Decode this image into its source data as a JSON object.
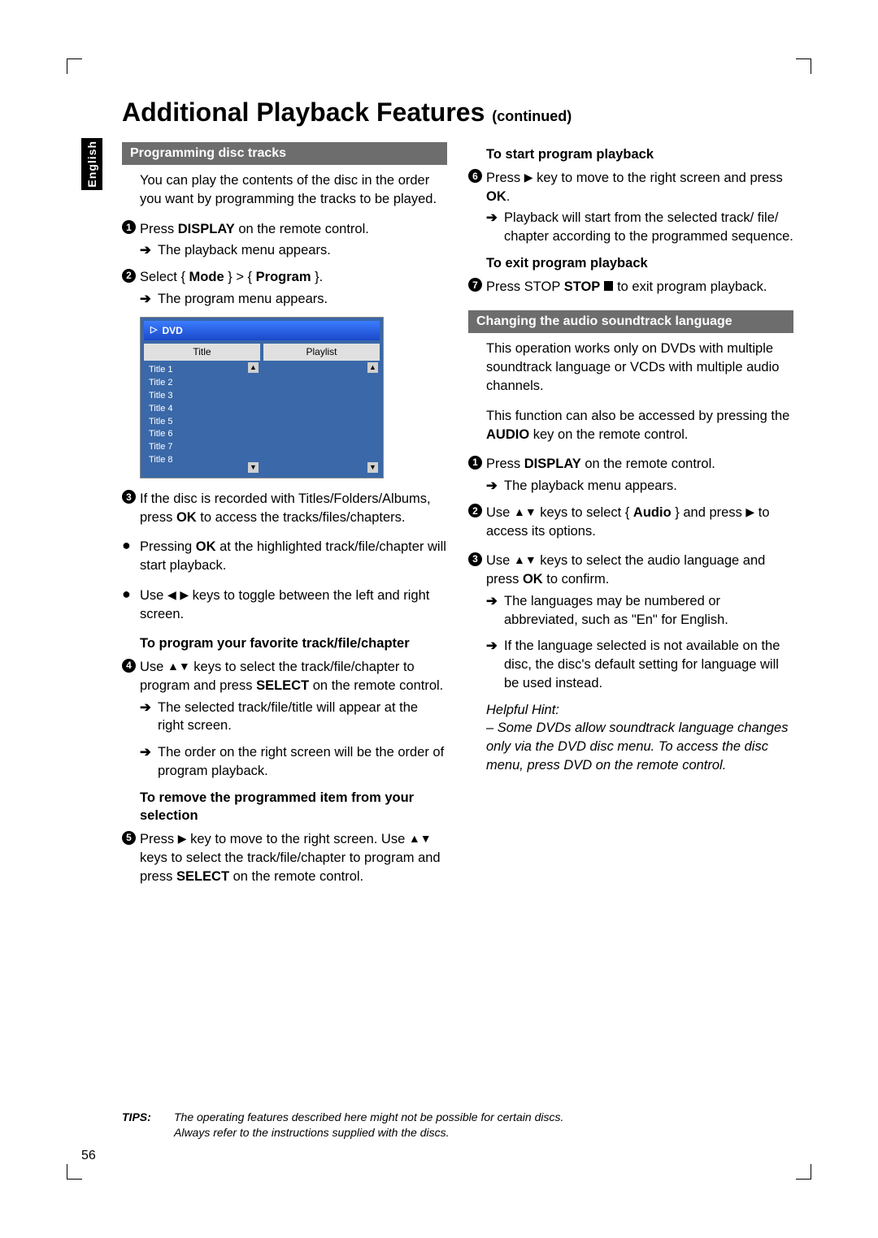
{
  "page_number": "56",
  "language_tab": "English",
  "title_main": "Additional Playback Features",
  "title_suffix": "(continued)",
  "section1": "Programming disc tracks",
  "intro1": "You can play the contents of the disc in the order you want by programming the tracks to be played.",
  "s1": "Press DISPLAY on the remote control.",
  "s1r": "The playback menu appears.",
  "s2": "Select { Mode } > { Program }.",
  "s2r": "The program menu appears.",
  "screenshot": {
    "hdr": "DVD",
    "left_h": "Title",
    "right_h": "Playlist",
    "titles": [
      "Title 1",
      "Title 2",
      "Title 3",
      "Title 4",
      "Title 5",
      "Title 6",
      "Title 7",
      "Title 8"
    ]
  },
  "s3": "If the disc is recorded with Titles/Folders/Albums, press OK to access the tracks/files/chapters.",
  "b1": "Pressing OK at the highlighted track/file/chapter will start playback.",
  "b2": "Use ◀ ▶ keys to toggle between the left and right screen.",
  "h1": "To program your favorite track/file/chapter",
  "s4": "Use ▲▼ keys to select the track/file/chapter to program and press SELECT on the remote control.",
  "s4r1": "The selected track/file/title will appear at the right screen.",
  "s4r2": "The order on the right screen will be the order of program playback.",
  "h2": "To remove the programmed item from your selection",
  "s5": "Press ▶ key to move to the right screen. Use ▲▼ keys to select the track/file/chapter to program and press SELECT on the remote control.",
  "h3": "To start program playback",
  "s6": "Press ▶ key to move to the right screen and press OK.",
  "s6r": "Playback will start from the selected track/ file/ chapter according to the programmed sequence.",
  "h4": "To exit program playback",
  "s7a": "Press STOP",
  "s7b": "to exit program playback.",
  "section2": "Changing the audio soundtrack language",
  "intro2": "This operation works only on DVDs with multiple soundtrack language or VCDs with multiple audio channels.",
  "intro2b": "This function can also be accessed by pressing the AUDIO key on the remote control.",
  "a1": "Press DISPLAY on the remote control.",
  "a1r": "The playback menu appears.",
  "a2": "Use ▲▼ keys to select { Audio } and press ▶ to access its options.",
  "a3": "Use ▲▼ keys to select the audio language and press OK to confirm.",
  "a3r1": "The languages may be numbered or abbreviated, such as \"En\" for English.",
  "a3r2": "If the language selected is not available on the disc, the disc's default setting for language will be used instead.",
  "hint_label": "Helpful Hint:",
  "hint_text": "– Some DVDs allow soundtrack language changes only via the DVD disc menu. To access the disc menu, press DVD on the remote control.",
  "tips_label": "TIPS:",
  "tips_text": "The operating features described here might not be possible for certain discs.\nAlways refer to the instructions supplied with the discs."
}
